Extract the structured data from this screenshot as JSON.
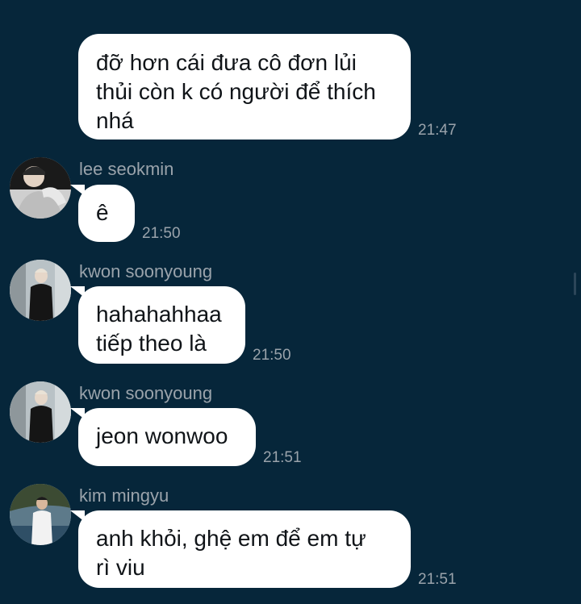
{
  "messages": [
    {
      "sender": "",
      "text_lines": [
        "đỡ hơn cái đưa cô đơn lủi",
        "thủi còn k có người để thích",
        "nhá"
      ],
      "time": "21:47",
      "avatar_icon": ""
    },
    {
      "sender": "lee seokmin",
      "text_lines": [
        "ê"
      ],
      "time": "21:50",
      "avatar_icon": "avatar-person-icon"
    },
    {
      "sender": "kwon soonyoung",
      "text_lines": [
        "hahahahhaa",
        "tiếp theo là"
      ],
      "time": "21:50",
      "avatar_icon": "avatar-person-icon"
    },
    {
      "sender": "kwon soonyoung",
      "text_lines": [
        "jeon wonwoo"
      ],
      "time": "21:51",
      "avatar_icon": "avatar-person-icon"
    },
    {
      "sender": "kim mingyu",
      "text_lines": [
        "anh khỏi, ghệ em để em tự",
        "rì viu"
      ],
      "time": "21:51",
      "avatar_icon": "avatar-person-icon"
    }
  ],
  "colors": {
    "background": "#06263a",
    "bubble": "#ffffff",
    "bubble_text": "#101418",
    "meta_text": "#9aa3ab"
  }
}
